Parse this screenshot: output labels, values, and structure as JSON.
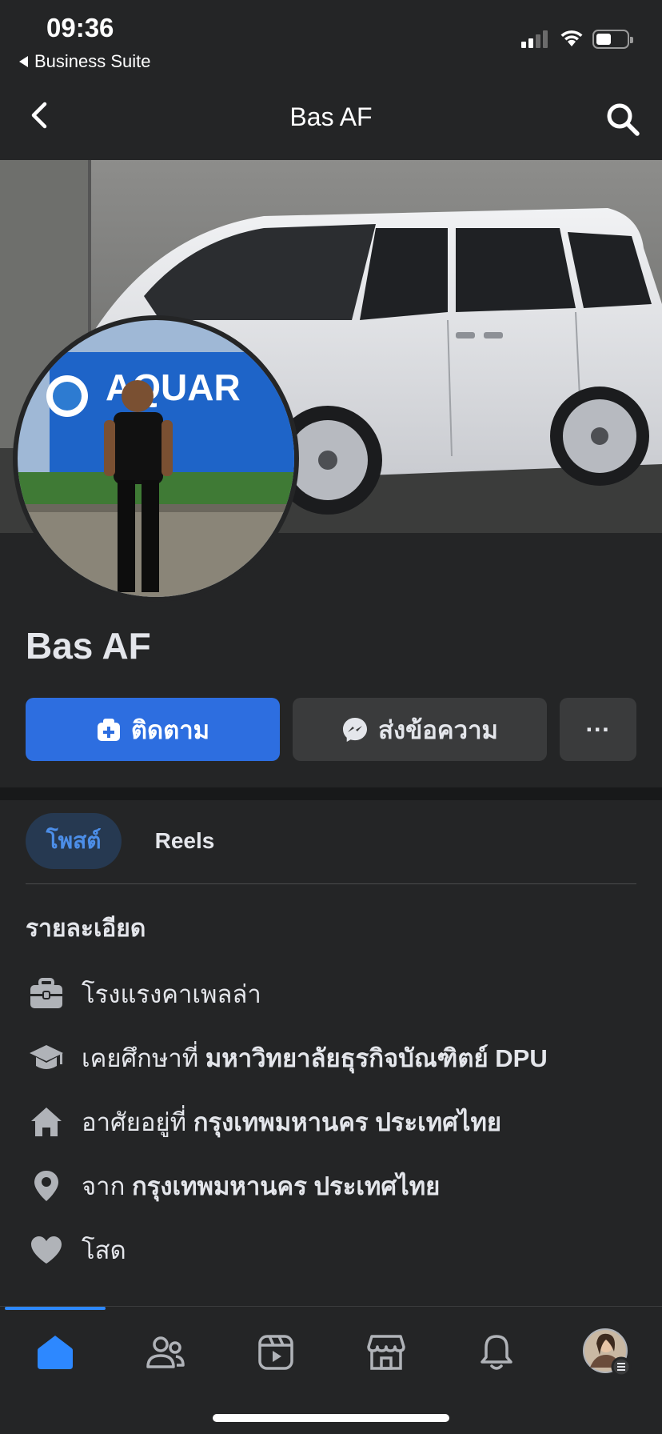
{
  "status_bar": {
    "time": "09:36",
    "back_app": "Business Suite"
  },
  "header": {
    "title": "Bas AF"
  },
  "profile": {
    "name": "Bas AF"
  },
  "actions": {
    "follow_label": "ติดตาม",
    "message_label": "ส่งข้อความ",
    "more_label": "···"
  },
  "tabs": [
    {
      "label": "โพสต์",
      "active": true
    },
    {
      "label": "Reels",
      "active": false
    }
  ],
  "details": {
    "heading": "รายละเอียด",
    "items": [
      {
        "icon": "briefcase-icon",
        "prefix": "",
        "value": "โรงแรงคาเพลล่า"
      },
      {
        "icon": "graduation-cap-icon",
        "prefix": "เคยศึกษาที่ ",
        "value": "มหาวิทยาลัยธุรกิจบัณฑิตย์ DPU"
      },
      {
        "icon": "home-icon",
        "prefix": "อาศัยอยู่ที่ ",
        "value": "กรุงเทพมหานคร ประเทศไทย"
      },
      {
        "icon": "location-pin-icon",
        "prefix": "จาก ",
        "value": "กรุงเทพมหานคร ประเทศไทย"
      },
      {
        "icon": "heart-icon",
        "prefix": "",
        "value": "โสด"
      }
    ]
  },
  "bottom_nav": [
    {
      "icon": "home-icon",
      "active": true
    },
    {
      "icon": "friends-icon",
      "active": false
    },
    {
      "icon": "video-icon",
      "active": false
    },
    {
      "icon": "marketplace-icon",
      "active": false
    },
    {
      "icon": "bell-icon",
      "active": false
    },
    {
      "icon": "profile-menu-icon",
      "active": false
    }
  ],
  "colors": {
    "background": "#242526",
    "accent": "#2d6ee0",
    "tab_active_bg": "#263951",
    "tab_active_text": "#4c8ee8",
    "secondary_button": "#3a3b3c"
  }
}
